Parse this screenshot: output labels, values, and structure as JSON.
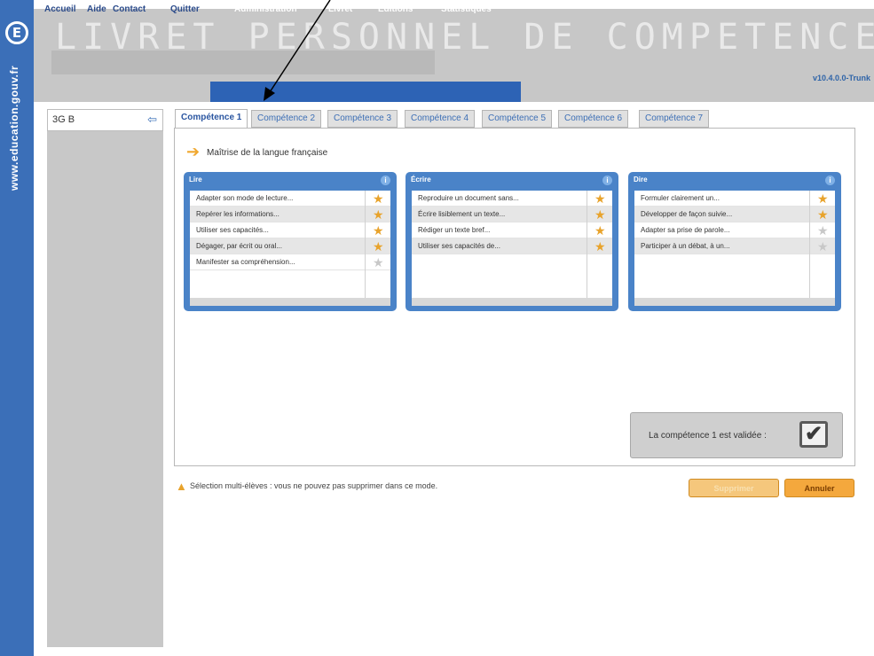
{
  "sidebar_strip": {
    "logo_letter": "E",
    "url": "www.education.gouv.fr"
  },
  "header": {
    "title": "LIVRET PERSONNEL DE COMPETENCES",
    "version": "v10.4.0.0-Trunk"
  },
  "menu": {
    "items": [
      "Accueil",
      "Aide",
      "Contact",
      "Quitter"
    ],
    "blue_items": [
      "Administration",
      "Livret",
      "Éditions",
      "Statistiques"
    ]
  },
  "left_panel": {
    "class": "3G B",
    "back_icon": "back-arrow-icon"
  },
  "tabs": [
    "Compétence 1",
    "Compétence 2",
    "Compétence 3",
    "Compétence 4",
    "Compétence 5",
    "Compétence 6",
    "Compétence 7"
  ],
  "section": {
    "title": "Maîtrise de la langue française"
  },
  "cards": [
    {
      "header": "Lire",
      "rows": [
        {
          "text": "Adapter son mode de lecture...",
          "star": "gold"
        },
        {
          "text": "Repérer les informations...",
          "star": "gold"
        },
        {
          "text": "Utiliser ses capacités...",
          "star": "gold"
        },
        {
          "text": "Dégager, par écrit ou oral...",
          "star": "gold"
        },
        {
          "text": "Manifester sa compréhension...",
          "star": "grey"
        }
      ]
    },
    {
      "header": "Écrire",
      "rows": [
        {
          "text": "Reproduire un document sans...",
          "star": "gold"
        },
        {
          "text": "Écrire lisiblement un texte...",
          "star": "gold"
        },
        {
          "text": "Rédiger un texte bref...",
          "star": "gold"
        },
        {
          "text": "Utiliser ses capacités de...",
          "star": "gold"
        }
      ]
    },
    {
      "header": "Dire",
      "rows": [
        {
          "text": "Formuler clairement un...",
          "star": "gold"
        },
        {
          "text": "Développer de façon suivie...",
          "star": "gold"
        },
        {
          "text": "Adapter sa prise de parole...",
          "star": "grey"
        },
        {
          "text": "Participer à un débat, à un...",
          "star": "grey"
        }
      ]
    }
  ],
  "validation": {
    "text": "La compétence 1 est validée :",
    "check": "✔"
  },
  "warning": {
    "text": "Sélection multi-élèves : vous ne pouvez pas supprimer dans ce mode."
  },
  "buttons": {
    "disabled_label": "Supprimer",
    "cancel_label": "Annuler"
  },
  "colors": {
    "accent": "#3b6fb8",
    "orange": "#f4a83d",
    "gold_star": "#e8a32c"
  }
}
